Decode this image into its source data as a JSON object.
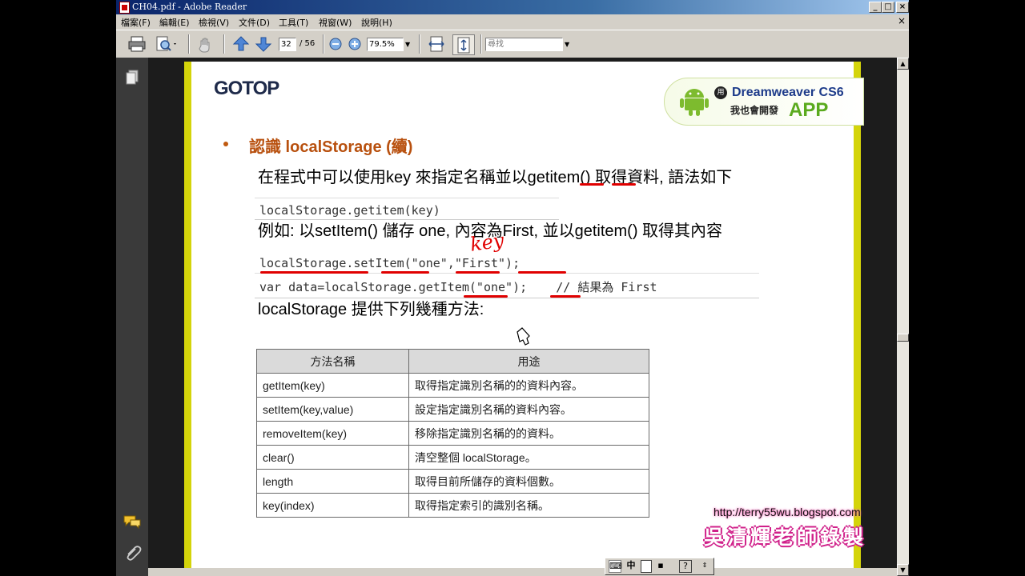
{
  "window": {
    "title": "CH04.pdf - Adobe Reader",
    "minimize": "_",
    "maximize": "□",
    "close": "×"
  },
  "menu": [
    {
      "label": "檔案(F)"
    },
    {
      "label": "編輯(E)"
    },
    {
      "label": "檢視(V)"
    },
    {
      "label": "文件(D)"
    },
    {
      "label": "工具(T)"
    },
    {
      "label": "視窗(W)"
    },
    {
      "label": "說明(H)"
    }
  ],
  "doc_close": "×",
  "toolbar": {
    "page_current": "32",
    "page_total": "/ 56",
    "zoom": "79.5%",
    "search_placeholder": "尋找"
  },
  "slide": {
    "logo": "GOTOP",
    "badge": {
      "prefix": "用",
      "line1": "Dreamweaver",
      "line1_suffix": "CS6",
      "line2": "我也會開發",
      "app": "APP"
    },
    "heading": "認識 localStorage (續)",
    "line1": "在程式中可以使用key 來指定名稱並以getitem() 取得資料, 語法如下",
    "code1": "localStorage.getitem(key)",
    "line2": "例如: 以setItem() 儲存 one, 內容為First, 並以getitem() 取得其內容",
    "code2a": "localStorage.setItem(\"one\",\"First\");",
    "code2b": "var data=localStorage.getItem(\"one\");    // 結果為 First",
    "annotation": "key",
    "line3": "localStorage 提供下列幾種方法:",
    "table": {
      "headers": [
        "方法名稱",
        "用途"
      ],
      "rows": [
        [
          "getItem(key)",
          "取得指定識別名稱的的資料內容。"
        ],
        [
          "setItem(key,value)",
          "設定指定識別名稱的資料內容。"
        ],
        [
          "removeItem(key)",
          "移除指定識別名稱的的資料。"
        ],
        [
          "clear()",
          "清空整個 localStorage。"
        ],
        [
          "length",
          "取得目前所儲存的資料個數。"
        ],
        [
          "key(index)",
          "取得指定索引的識別名稱。"
        ]
      ]
    },
    "blog": "http://terry55wu.blogspot.com",
    "teacher": "吳清輝老師錄製"
  },
  "ime": {
    "mode": "中",
    "help": "?"
  },
  "icons": [
    "pdf-icon",
    "print-icon",
    "search-icon",
    "hand-icon",
    "up-arrow-icon",
    "down-arrow-icon",
    "zoom-out-icon",
    "zoom-in-icon",
    "fit-page-icon",
    "fit-width-icon",
    "pages-icon",
    "comment-icon",
    "paperclip-icon",
    "android-icon",
    "cursor-icon"
  ]
}
